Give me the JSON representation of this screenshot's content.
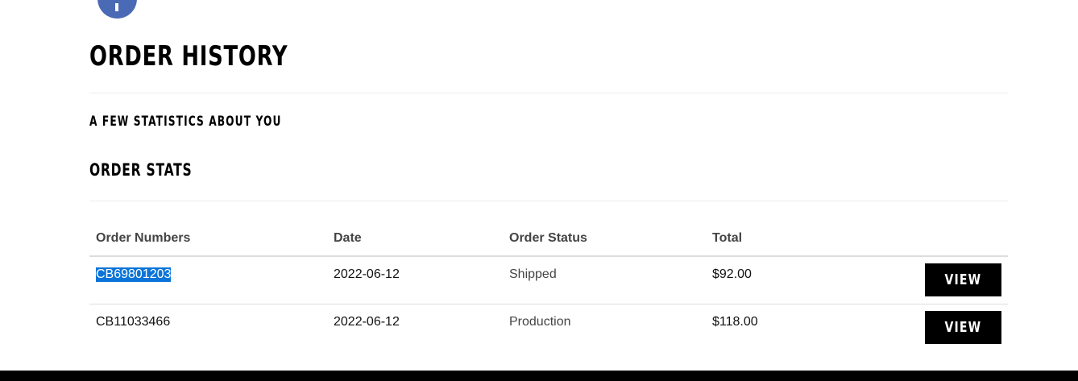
{
  "avatar": {
    "icon": "facebook-icon",
    "color": "#4a6ab5"
  },
  "page": {
    "title": "ORDER HISTORY",
    "subtitle": "A FEW STATISTICS ABOUT YOU",
    "section_title": "ORDER STATS"
  },
  "table": {
    "headers": {
      "order_numbers": "Order Numbers",
      "date": "Date",
      "order_status": "Order Status",
      "total": "Total"
    },
    "rows": [
      {
        "order_number": "CB69801203",
        "date": "2022-06-12",
        "status": "Shipped",
        "total": "$92.00",
        "action_label": "VIEW",
        "selected": true
      },
      {
        "order_number": "CB11033466",
        "date": "2022-06-12",
        "status": "Production",
        "total": "$118.00",
        "action_label": "VIEW",
        "selected": false
      }
    ]
  },
  "colors": {
    "selection": "#0a74d8",
    "button_bg": "#000000",
    "footer": "#000000"
  }
}
